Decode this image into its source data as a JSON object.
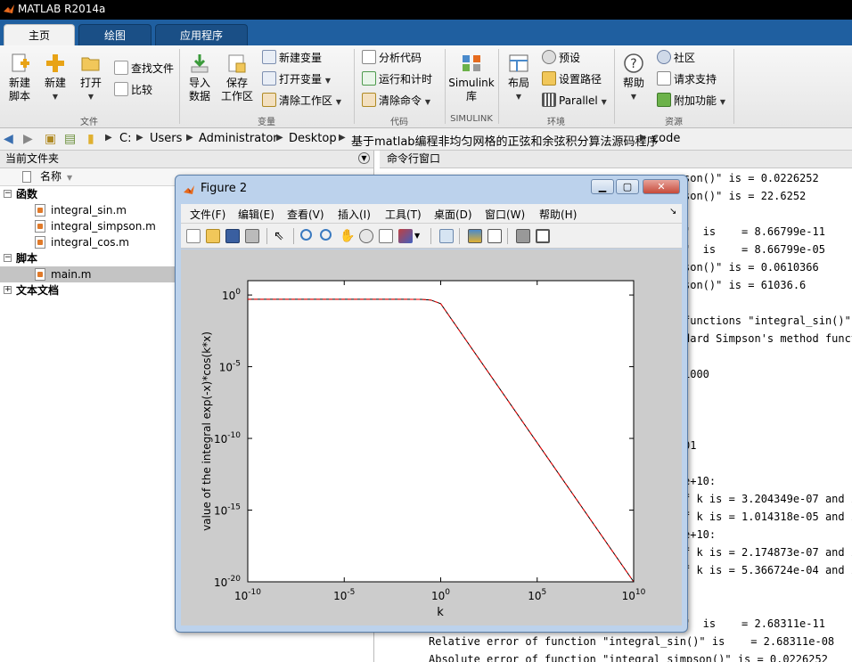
{
  "window": {
    "title": "MATLAB R2014a"
  },
  "tabs": [
    {
      "label": "主页"
    },
    {
      "label": "绘图"
    },
    {
      "label": "应用程序"
    }
  ],
  "ribbon": {
    "file": {
      "group_label": "文件",
      "new_script": "新建\n脚本",
      "new": "新建",
      "open": "打开",
      "find_files": "查找文件",
      "compare": "比较"
    },
    "variable": {
      "group_label": "变量",
      "import_data": "导入\n数据",
      "save_workspace": "保存\n工作区",
      "new_variable": "新建变量",
      "open_variable": "打开变量",
      "clear_workspace": "清除工作区"
    },
    "code": {
      "group_label": "代码",
      "analyze_code": "分析代码",
      "run_and_time": "运行和计时",
      "clear_commands": "清除命令"
    },
    "simulink": {
      "group_label": "SIMULINK",
      "library": "Simulink\n库"
    },
    "environment": {
      "group_label": "环境",
      "layout": "布局",
      "preferences": "预设",
      "set_path": "设置路径",
      "parallel": "Parallel"
    },
    "resources": {
      "group_label": "资源",
      "help": "帮助",
      "community": "社区",
      "request_support": "请求支持",
      "add_ons": "附加功能"
    }
  },
  "address": {
    "crumbs": [
      "C:",
      "Users",
      "Administrator",
      "Desktop",
      "基于matlab编程非均匀网格的正弦和余弦积分算法源码程序",
      "code"
    ]
  },
  "current_folder": {
    "title": "当前文件夹",
    "name_header": "名称",
    "groups": [
      {
        "label": "函数",
        "items": [
          "integral_sin.m",
          "integral_simpson.m",
          "integral_cos.m"
        ]
      },
      {
        "label": "脚本",
        "items": [
          "main.m"
        ]
      },
      {
        "label": "文本文档",
        "items": []
      }
    ]
  },
  "command_window": {
    "title": "命令行窗口",
    "lines": [
      "son()\" is = 0.0226252",
      "son()\" is = 22.6252",
      "\"  is    = 8.66799e-11",
      "\"  is    = 8.66799e-05",
      "son()\" is = 0.0610366",
      "son()\" is = 61036.6",
      "functions \"integral_sin()\"",
      "dard Simpson's method funct",
      "1000",
      "01",
      "e+10:",
      "f k is = 3.204349e-07 and i",
      "f k is = 1.014318e-05 and i",
      "e+10:",
      "f k is = 2.174873e-07 and i",
      "f k is = 5.366724e-04 and i",
      "\"  is    = 2.68311e-11",
      "Relative error of function \"integral_sin()\" is    = 2.68311e-08",
      "Absolute error of function \"integral_simpson()\" is = 0.0226252"
    ]
  },
  "figure": {
    "title": "Figure 2",
    "menu": [
      "文件(F)",
      "编辑(E)",
      "查看(V)",
      "插入(I)",
      "工具(T)",
      "桌面(D)",
      "窗口(W)",
      "帮助(H)"
    ],
    "dock_icon": "dock-arrow-icon"
  },
  "chart_data": {
    "type": "line",
    "title": "",
    "xlabel": "k",
    "ylabel": "value of the integral exp(-x)*cos(k*x)",
    "xscale": "log",
    "yscale": "log",
    "xlim": [
      1e-10,
      10000000000.0
    ],
    "ylim": [
      1e-20,
      10.0
    ],
    "x_tick_labels": [
      {
        "base": "10",
        "exp": "-10"
      },
      {
        "base": "10",
        "exp": "-5"
      },
      {
        "base": "10",
        "exp": "0"
      },
      {
        "base": "10",
        "exp": "5"
      },
      {
        "base": "10",
        "exp": "10"
      }
    ],
    "y_tick_labels": [
      {
        "base": "10",
        "exp": "0"
      },
      {
        "base": "10",
        "exp": "-5"
      },
      {
        "base": "10",
        "exp": "-10"
      },
      {
        "base": "10",
        "exp": "-15"
      },
      {
        "base": "10",
        "exp": "-20"
      }
    ],
    "grid": false,
    "series": [
      {
        "color": "#000000",
        "style": "solid",
        "x": [
          1e-10,
          0.01,
          0.1,
          0.3,
          1,
          10000000000.0
        ],
        "y": [
          0.5,
          0.5,
          0.495,
          0.45,
          0.25,
          1e-20
        ]
      },
      {
        "color": "#ff0000",
        "style": "dashed",
        "x": [
          1e-10,
          0.01,
          0.1,
          0.3,
          1,
          10000000000.0
        ],
        "y": [
          0.5,
          0.5,
          0.495,
          0.45,
          0.25,
          1e-20
        ]
      }
    ]
  }
}
